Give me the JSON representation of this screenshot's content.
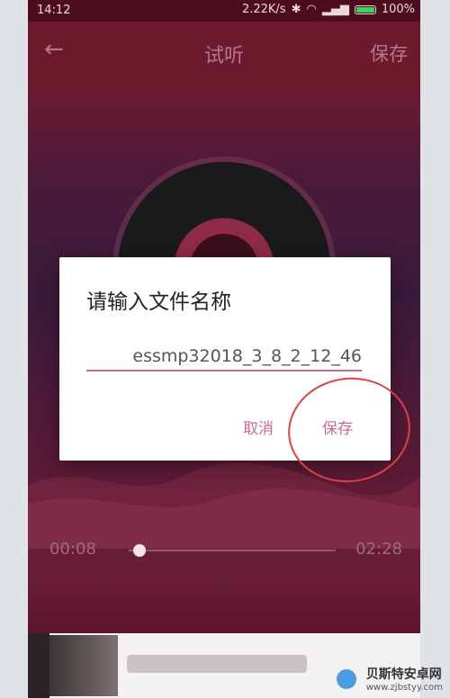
{
  "status_bar": {
    "time": "14:12",
    "network_speed": "2.22K/s",
    "battery": "100%"
  },
  "app_bar": {
    "title": "试听",
    "save_label": "保存"
  },
  "player": {
    "elapsed": "00:08",
    "duration": "02:28",
    "progress": 0.054
  },
  "dialog": {
    "title": "请输入文件名称",
    "filename_value": "essmp32018_3_8_2_12_46",
    "cancel_label": "取消",
    "save_label": "保存"
  },
  "watermark": {
    "brand": "贝斯特安卓网",
    "url": "www.zjbstyy.com"
  },
  "colors": {
    "accent": "#c96a94",
    "app_bar": "#6e1a2e",
    "annotation_circle": "#e04040"
  }
}
